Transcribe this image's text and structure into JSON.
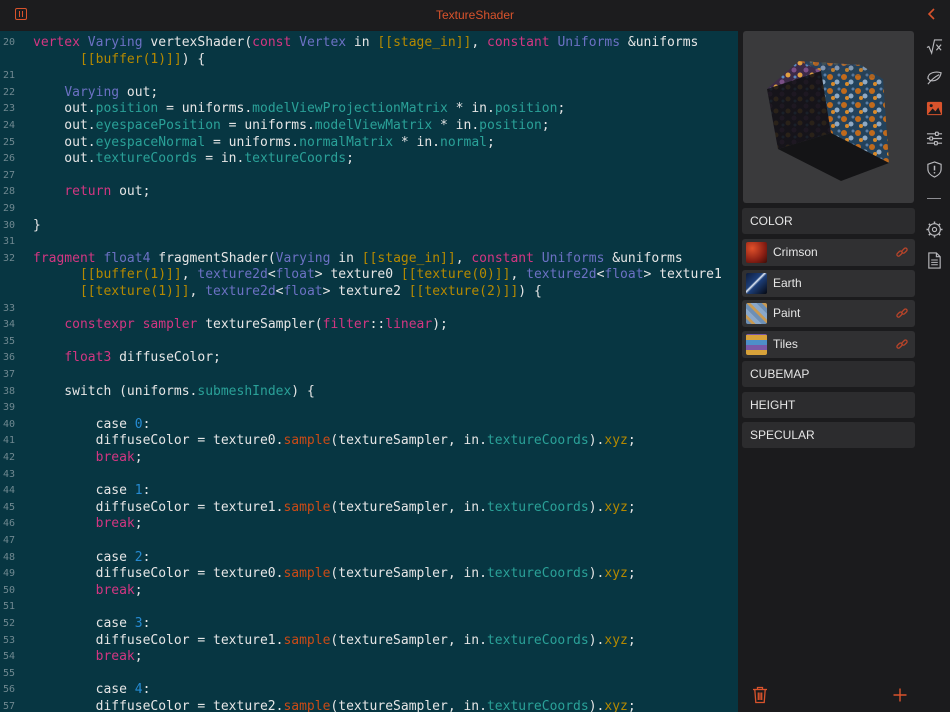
{
  "window": {
    "title": "TextureShader"
  },
  "editor": {
    "lines": [
      {
        "n": "20",
        "html": "<span class=\"kw\">vertex</span> <span class=\"ty\">Varying</span> vertexShader(<span class=\"kw\">const</span> <span class=\"ty\">Vertex</span> in <span class=\"at\">[[stage_in]]</span>, <span class=\"kw\">constant</span> <span class=\"ty\">Uniforms</span> &amp;uniforms"
      },
      {
        "n": "",
        "html": "      <span class=\"at\">[[buffer(1)]]</span>) {"
      },
      {
        "n": "21",
        "html": ""
      },
      {
        "n": "22",
        "html": "    <span class=\"ty\">Varying</span> out;"
      },
      {
        "n": "23",
        "html": "    out.<span class=\"mb\">position</span> = uniforms.<span class=\"mb\">modelViewProjectionMatrix</span> * in.<span class=\"mb\">position</span>;"
      },
      {
        "n": "24",
        "html": "    out.<span class=\"mb\">eyespacePosition</span> = uniforms.<span class=\"mb\">modelViewMatrix</span> * in.<span class=\"mb\">position</span>;"
      },
      {
        "n": "25",
        "html": "    out.<span class=\"mb\">eyespaceNormal</span> = uniforms.<span class=\"mb\">normalMatrix</span> * in.<span class=\"mb\">normal</span>;"
      },
      {
        "n": "26",
        "html": "    out.<span class=\"mb\">textureCoords</span> = in.<span class=\"mb\">textureCoords</span>;"
      },
      {
        "n": "27",
        "html": ""
      },
      {
        "n": "28",
        "html": "    <span class=\"kw\">return</span> out;"
      },
      {
        "n": "29",
        "html": ""
      },
      {
        "n": "30",
        "html": "}"
      },
      {
        "n": "31",
        "html": ""
      },
      {
        "n": "32",
        "html": "<span class=\"kw\">fragment</span> <span class=\"ty\">float4</span> fragmentShader(<span class=\"ty\">Varying</span> in <span class=\"at\">[[stage_in]]</span>, <span class=\"kw\">constant</span> <span class=\"ty\">Uniforms</span> &amp;uniforms"
      },
      {
        "n": "",
        "html": "      <span class=\"at\">[[buffer(1)]]</span>, <span class=\"ty\">texture2d</span>&lt;<span class=\"ty\">float</span>&gt; texture0 <span class=\"at\">[[texture(0)]]</span>, <span class=\"ty\">texture2d</span>&lt;<span class=\"ty\">float</span>&gt; texture1"
      },
      {
        "n": "",
        "html": "      <span class=\"at\">[[texture(1)]]</span>, <span class=\"ty\">texture2d</span>&lt;<span class=\"ty\">float</span>&gt; texture2 <span class=\"at\">[[texture(2)]]</span>) {"
      },
      {
        "n": "33",
        "html": ""
      },
      {
        "n": "34",
        "html": "    <span class=\"kw\">constexpr</span> <span class=\"kw\">sampler</span> textureSampler(<span class=\"kw\">filter</span>::<span class=\"kw\">linear</span>);"
      },
      {
        "n": "35",
        "html": ""
      },
      {
        "n": "36",
        "html": "    <span class=\"kw\">float3</span> diffuseColor;"
      },
      {
        "n": "37",
        "html": ""
      },
      {
        "n": "38",
        "html": "    switch (uniforms.<span class=\"mb\">submeshIndex</span>) {"
      },
      {
        "n": "39",
        "html": ""
      },
      {
        "n": "40",
        "html": "        case <span class=\"nm\">0</span>:"
      },
      {
        "n": "41",
        "html": "        diffuseColor = texture0.<span class=\"fn\">sample</span>(textureSampler, in.<span class=\"mb\">textureCoords</span>).<span class=\"at\">xyz</span>;"
      },
      {
        "n": "42",
        "html": "        <span class=\"kw\">break</span>;"
      },
      {
        "n": "43",
        "html": ""
      },
      {
        "n": "44",
        "html": "        case <span class=\"nm\">1</span>:"
      },
      {
        "n": "45",
        "html": "        diffuseColor = texture1.<span class=\"fn\">sample</span>(textureSampler, in.<span class=\"mb\">textureCoords</span>).<span class=\"at\">xyz</span>;"
      },
      {
        "n": "46",
        "html": "        <span class=\"kw\">break</span>;"
      },
      {
        "n": "47",
        "html": ""
      },
      {
        "n": "48",
        "html": "        case <span class=\"nm\">2</span>:"
      },
      {
        "n": "49",
        "html": "        diffuseColor = texture0.<span class=\"fn\">sample</span>(textureSampler, in.<span class=\"mb\">textureCoords</span>).<span class=\"at\">xyz</span>;"
      },
      {
        "n": "50",
        "html": "        <span class=\"kw\">break</span>;"
      },
      {
        "n": "51",
        "html": ""
      },
      {
        "n": "52",
        "html": "        case <span class=\"nm\">3</span>:"
      },
      {
        "n": "53",
        "html": "        diffuseColor = texture1.<span class=\"fn\">sample</span>(textureSampler, in.<span class=\"mb\">textureCoords</span>).<span class=\"at\">xyz</span>;"
      },
      {
        "n": "54",
        "html": "        <span class=\"kw\">break</span>;"
      },
      {
        "n": "55",
        "html": ""
      },
      {
        "n": "56",
        "html": "        case <span class=\"nm\">4</span>:"
      },
      {
        "n": "57",
        "html": "        diffuseColor = texture2.<span class=\"fn\">sample</span>(textureSampler, in.<span class=\"mb\">textureCoords</span>).<span class=\"at\">xyz</span>;"
      }
    ]
  },
  "sidebar": {
    "sections": {
      "color": "COLOR",
      "cubemap": "CUBEMAP",
      "height": "HEIGHT",
      "specular": "SPECULAR"
    },
    "textures": [
      {
        "label": "Crimson",
        "linked": true
      },
      {
        "label": "Earth",
        "linked": false
      },
      {
        "label": "Paint",
        "linked": true
      },
      {
        "label": "Tiles",
        "linked": true
      }
    ]
  },
  "toolbar": {
    "icons": [
      "sqrt-icon",
      "leaf-icon",
      "image-icon",
      "sliders-icon",
      "shield-icon",
      "gear-icon",
      "document-icon"
    ]
  },
  "colors": {
    "accent": "#d9532c",
    "editor_background": "#073642",
    "keyword": "#d33682",
    "type": "#6c71c4",
    "attribute": "#b58900",
    "member": "#2aa198",
    "number": "#268bd2"
  }
}
